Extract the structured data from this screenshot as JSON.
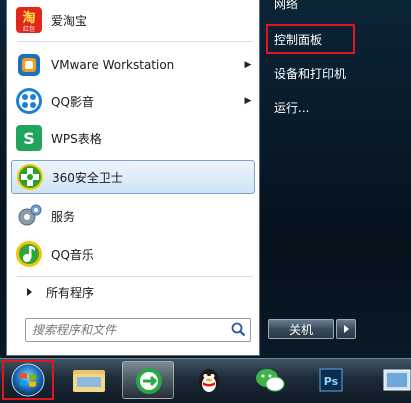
{
  "right_panel": {
    "top_item": "网络",
    "control_panel": "控制面板",
    "devices": "设备和打印机",
    "run": "运行..."
  },
  "programs": [
    {
      "label": "爱淘宝",
      "icon": "taobao-icon",
      "icon_text": "淘",
      "icon_sub": "红包",
      "submenu": false
    },
    {
      "label": "VMware Workstation",
      "icon": "vmware-icon",
      "submenu": true
    },
    {
      "label": "QQ影音",
      "icon": "qqplayer-icon",
      "submenu": true
    },
    {
      "label": "WPS表格",
      "icon": "wps-spreadsheet-icon",
      "icon_text": "S",
      "submenu": false
    },
    {
      "label": "360安全卫士",
      "icon": "360-safe-icon",
      "submenu": false,
      "highlighted": true
    },
    {
      "label": "服务",
      "icon": "services-gear-icon",
      "submenu": false
    },
    {
      "label": "QQ音乐",
      "icon": "qqmusic-icon",
      "submenu": false
    }
  ],
  "all_programs": "所有程序",
  "search": {
    "placeholder": "搜索程序和文件"
  },
  "shutdown": {
    "label": "关机"
  },
  "taskbar": {
    "items": [
      "start-orb-icon",
      "file-explorer-icon",
      "360-browser-icon",
      "qq-icon",
      "wechat-icon",
      "photoshop-icon",
      "desktop-icon"
    ],
    "ps_text": "Ps"
  },
  "colors": {
    "highlight_border": "#e3141b",
    "accent": "#7da2ce"
  }
}
